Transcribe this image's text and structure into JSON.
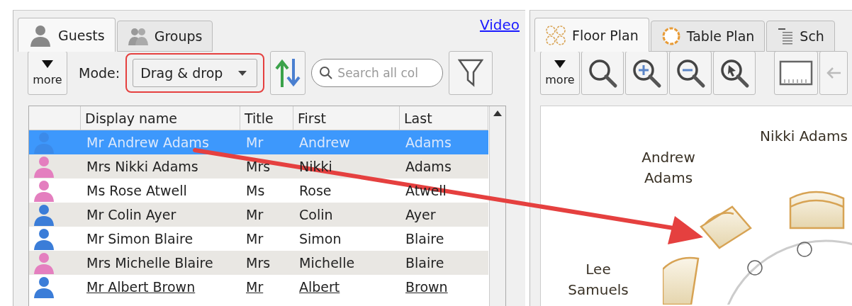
{
  "guests_panel": {
    "tabs": [
      {
        "label": "Guests",
        "kind": "guest",
        "selected": true
      },
      {
        "label": "Groups",
        "kind": "group",
        "selected": false
      }
    ],
    "video_link": "Video",
    "toolbar": {
      "more_label": "more",
      "mode_label": "Mode:",
      "mode_value": "Drag & drop",
      "mode_highlighted": true,
      "search": {
        "placeholder": "Search all col"
      }
    },
    "table": {
      "columns": [
        "Display name",
        "Title",
        "First",
        "Last"
      ],
      "rows": [
        {
          "kind": "male",
          "selected": true,
          "hovered": false,
          "cells": [
            "Mr Andrew Adams",
            "Mr",
            "Andrew",
            "Adams"
          ]
        },
        {
          "kind": "female",
          "selected": false,
          "hovered": false,
          "cells": [
            "Mrs Nikki Adams",
            "Mrs",
            "Nikki",
            "Adams"
          ]
        },
        {
          "kind": "female",
          "selected": false,
          "hovered": false,
          "cells": [
            "Ms Rose Atwell",
            "Ms",
            "Rose",
            "Atwell"
          ]
        },
        {
          "kind": "male",
          "selected": false,
          "hovered": false,
          "cells": [
            "Mr Colin Ayer",
            "Mr",
            "Colin",
            "Ayer"
          ]
        },
        {
          "kind": "male",
          "selected": false,
          "hovered": false,
          "cells": [
            "Mr Simon Blaire",
            "Mr",
            "Simon",
            "Blaire"
          ]
        },
        {
          "kind": "female",
          "selected": false,
          "hovered": false,
          "cells": [
            "Mrs Michelle Blaire",
            "Mrs",
            "Michelle",
            "Blaire"
          ]
        },
        {
          "kind": "male",
          "selected": false,
          "hovered": true,
          "cells": [
            "Mr Albert Brown",
            "Mr",
            "Albert",
            "Brown"
          ]
        }
      ]
    }
  },
  "plan_panel": {
    "tabs": [
      {
        "label": "Floor Plan",
        "kind": "floor",
        "selected": true
      },
      {
        "label": "Table Plan",
        "kind": "table",
        "selected": false
      },
      {
        "label": "Sch",
        "kind": "schedule",
        "selected": false
      }
    ],
    "toolbar": {
      "more_label": "more"
    },
    "canvas": {
      "labels": [
        {
          "text": "Nikki Adams",
          "kind": "top"
        },
        {
          "text": "Andrew Adams",
          "kind": "upper-left"
        },
        {
          "text": "Lee Samuels",
          "kind": "left"
        }
      ]
    }
  }
}
